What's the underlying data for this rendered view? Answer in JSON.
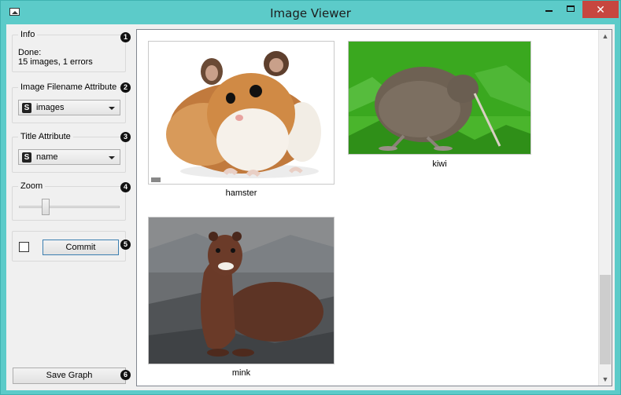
{
  "window": {
    "title": "Image Viewer",
    "close_glyph": "✕"
  },
  "info": {
    "title": "Info",
    "line1": "Done:",
    "line2": "15 images, 1 errors",
    "badge": "1"
  },
  "filename_attr": {
    "title": "Image Filename Attribute",
    "type_icon": "S",
    "value": "images",
    "badge": "2"
  },
  "title_attr": {
    "title": "Title Attribute",
    "type_icon": "S",
    "value": "name",
    "badge": "3"
  },
  "zoom": {
    "title": "Zoom",
    "badge": "4",
    "level": 0.25
  },
  "commit": {
    "label": "Commit",
    "badge": "5",
    "checked": false
  },
  "save": {
    "label": "Save Graph",
    "badge": "6"
  },
  "images": [
    {
      "caption": "hamster"
    },
    {
      "caption": "kiwi"
    },
    {
      "caption": "mink"
    }
  ],
  "scrollbar": {
    "up": "▲",
    "down": "▼"
  }
}
